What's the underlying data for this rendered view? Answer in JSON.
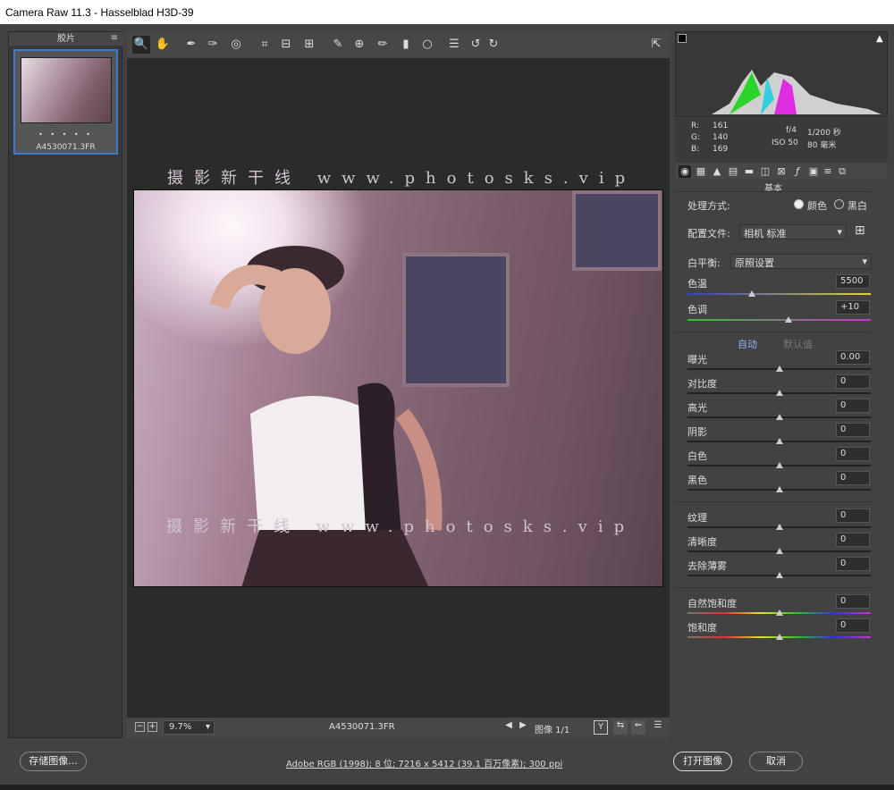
{
  "window": {
    "title": "Camera Raw 11.3 -  Hasselblad H3D-39"
  },
  "filmstrip": {
    "title": "胶片",
    "menu_icon": "≡",
    "dots": "• • • • •",
    "file": "A4530071.3FR"
  },
  "toolbar": {
    "icons": [
      "zoom-icon",
      "hand-icon",
      "white-balance-icon",
      "color-sampler-icon",
      "target-adjust-icon",
      "crop-icon",
      "straighten-icon",
      "transform-icon",
      "spot-removal-icon",
      "red-eye-icon",
      "adjustment-brush-icon",
      "graduated-filter-icon",
      "radial-filter-icon",
      "preferences-icon",
      "rotate-left-icon",
      "rotate-right-icon",
      "fullscreen-icon"
    ]
  },
  "photo": {
    "watermark_top": "摄影新干线 www.photosks.vip",
    "watermark_bottom": "摄影新干线 www.photosks.vip"
  },
  "bottombar": {
    "zoom": "9.7%",
    "filename": "A4530071.3FR",
    "image_label": "图像 1/1",
    "y_btn": "Y"
  },
  "histogram": {
    "rgb_r": "R:",
    "rgb_r_val": "161",
    "rgb_g": "G:",
    "rgb_g_val": "140",
    "rgb_b": "B:",
    "rgb_b_val": "169",
    "aperture": "f/4",
    "shutter": "1/200 秒",
    "iso": "ISO 50",
    "focal": "80 毫米"
  },
  "panel": {
    "title": "基本",
    "process_label": "处理方式:",
    "color_label": "颜色",
    "bw_label": "黑白",
    "profile_label": "配置文件:",
    "profile_value": "相机 标准",
    "wb_label": "白平衡:",
    "wb_value": "原照设置",
    "temp_label": "色温",
    "temp_value": "5500",
    "tint_label": "色调",
    "tint_value": "+10",
    "auto_label": "自动",
    "default_label": "默认值",
    "exposure_label": "曝光",
    "exposure_value": "0.00",
    "contrast_label": "对比度",
    "contrast_value": "0",
    "highlights_label": "高光",
    "highlights_value": "0",
    "shadows_label": "阴影",
    "shadows_value": "0",
    "whites_label": "白色",
    "whites_value": "0",
    "blacks_label": "黑色",
    "blacks_value": "0",
    "texture_label": "纹理",
    "texture_value": "0",
    "clarity_label": "清晰度",
    "clarity_value": "0",
    "dehaze_label": "去除薄雾",
    "dehaze_value": "0",
    "vibrance_label": "自然饱和度",
    "vibrance_value": "0",
    "saturation_label": "饱和度",
    "saturation_value": "0"
  },
  "footer": {
    "save": "存储图像...",
    "info": "Adobe RGB (1998); 8 位; 7216 x 5412 (39.1 百万像素); 300 ppi",
    "open": "打开图像",
    "cancel": "取消"
  },
  "sliders": {
    "temp": 0.35,
    "tint": 0.55,
    "exposure": 0.5,
    "contrast": 0.5,
    "highlights": 0.5,
    "shadows": 0.5,
    "whites": 0.5,
    "blacks": 0.5,
    "texture": 0.5,
    "clarity": 0.5,
    "dehaze": 0.5,
    "vibrance": 0.5,
    "saturation": 0.5
  }
}
